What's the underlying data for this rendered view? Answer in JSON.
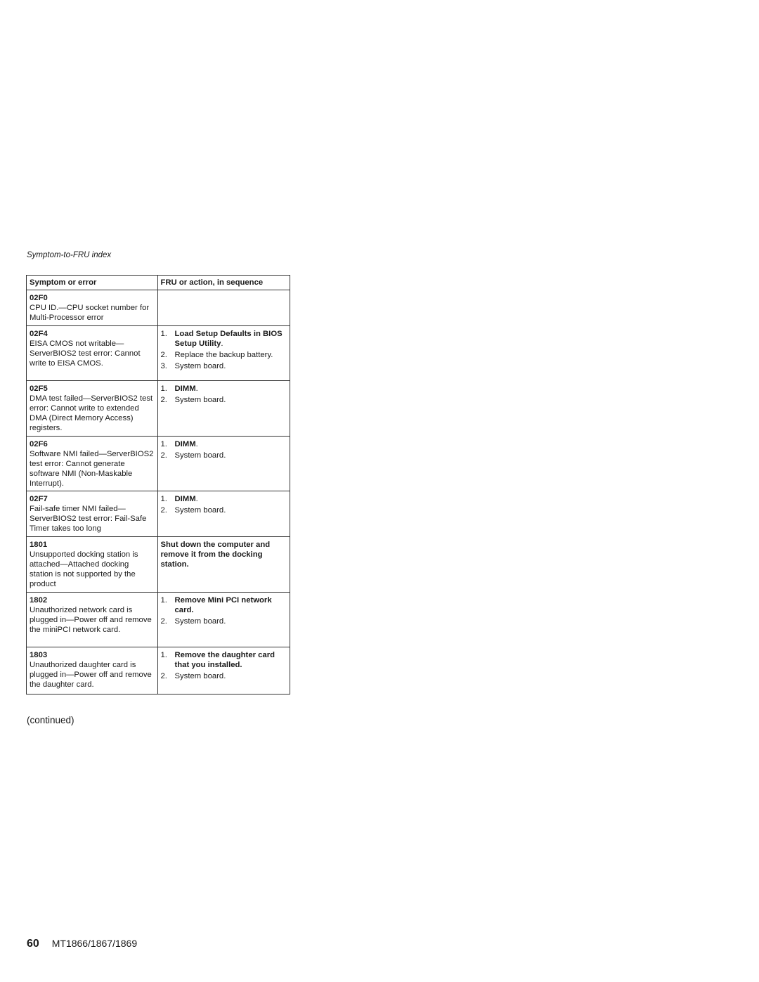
{
  "running_head": "Symptom-to-FRU index",
  "table": {
    "headers": [
      "Symptom or error",
      "FRU or action, in sequence"
    ],
    "rows": [
      {
        "code": "02F0",
        "description": "CPU ID.—CPU socket number for Multi-Processor error",
        "actions": []
      },
      {
        "code": "02F4",
        "description": "EISA CMOS not writable—ServerBIOS2 test error: Cannot write to EISA CMOS.",
        "actions": [
          {
            "num": "1.",
            "bold": "Load Setup Defaults in BIOS Setup Utility",
            "text": "."
          },
          {
            "num": "2.",
            "bold": "",
            "text": "Replace the backup battery."
          },
          {
            "num": "3.",
            "bold": "",
            "text": "System board."
          }
        ]
      },
      {
        "code": "02F5",
        "description": "DMA test failed—ServerBIOS2 test error: Cannot write to extended DMA (Direct Memory Access) registers.",
        "actions": [
          {
            "num": "1.",
            "bold": "DIMM",
            "text": "."
          },
          {
            "num": "2.",
            "bold": "",
            "text": "System board."
          }
        ]
      },
      {
        "code": "02F6",
        "description": "Software NMI failed—ServerBIOS2 test error: Cannot generate software NMI (Non-Maskable Interrupt).",
        "actions": [
          {
            "num": "1.",
            "bold": "DIMM",
            "text": "."
          },
          {
            "num": "2.",
            "bold": "",
            "text": "System board."
          }
        ]
      },
      {
        "code": "02F7",
        "description": "Fail-safe timer NMI failed—ServerBIOS2 test error: Fail-Safe Timer takes too long",
        "actions": [
          {
            "num": "1.",
            "bold": "DIMM",
            "text": "."
          },
          {
            "num": "2.",
            "bold": "",
            "text": "System board."
          }
        ]
      },
      {
        "code": "1801",
        "description": "Unsupported docking station is attached—Attached docking station is not supported by the product",
        "action_text": "Shut down the computer and remove it from the docking station."
      },
      {
        "code": "1802",
        "description": "Unauthorized network card is plugged in—Power off and remove the miniPCI network card.",
        "actions": [
          {
            "num": "1.",
            "bold": "Remove Mini PCI network card.",
            "text": ""
          },
          {
            "num": "2.",
            "bold": "",
            "text": "System board."
          }
        ]
      },
      {
        "code": "1803",
        "description": "Unauthorized daughter card is plugged in—Power off and remove the daughter card.",
        "actions": [
          {
            "num": "1.",
            "bold": "Remove the daughter card that you installed.",
            "text": ""
          },
          {
            "num": "2.",
            "bold": "",
            "text": "System board."
          }
        ]
      }
    ]
  },
  "continued": "(continued)",
  "footer": {
    "page_number": "60",
    "model": "MT1866/1867/1869"
  }
}
